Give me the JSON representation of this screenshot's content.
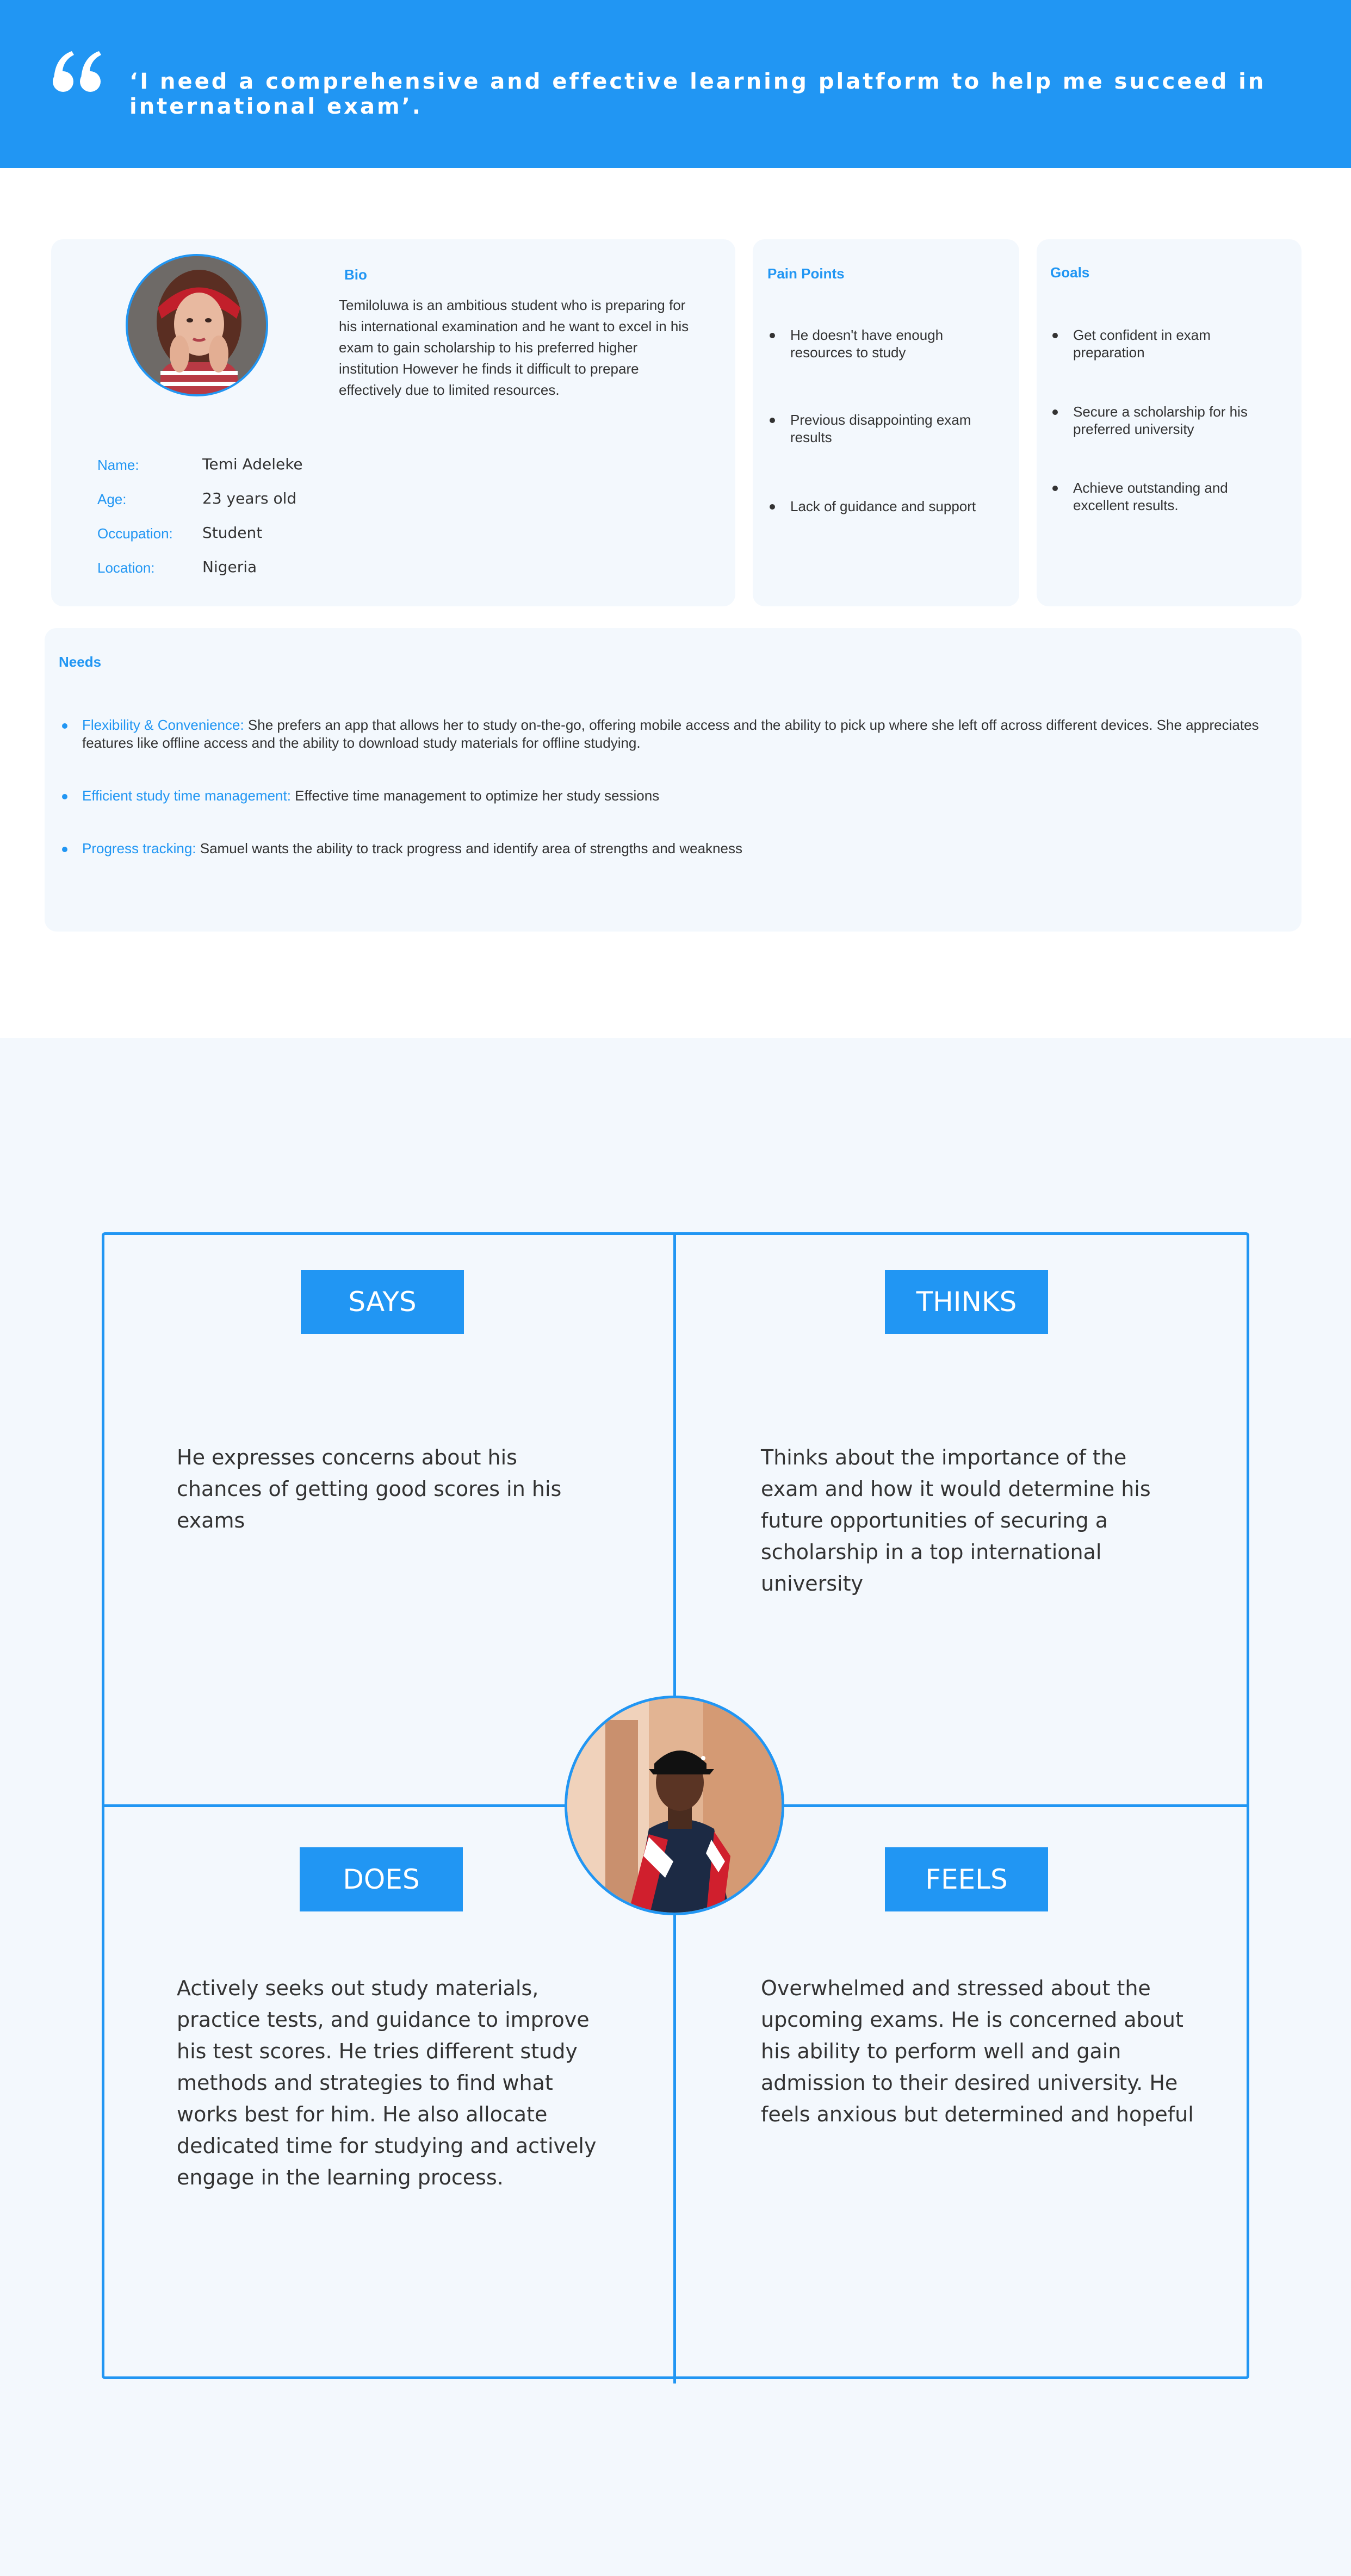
{
  "theme": {
    "accent": "#2196F3",
    "card_bg": "#F3F8FD",
    "text": "#333333",
    "banner_text": "#FFFFFF"
  },
  "banner": {
    "icon": "quote-icon",
    "quote": "‘I need a comprehensive and effective learning platform to help me succeed in international exam’."
  },
  "profile": {
    "avatar": "female-student-avatar",
    "bio_title": "Bio",
    "bio": "Temiloluwa is an ambitious student who is preparing for his international examination and he want to excel in his exam to gain scholarship to his preferred higher institution However he finds it difficult to prepare effectively due to limited resources.",
    "name_label": "Name:",
    "name_value": "Temi Adeleke",
    "age_label": "Age:",
    "age_value": "23  years old",
    "occupation_label": "Occupation:",
    "occupation_value": "Student",
    "location_label": "Location:",
    "location_value": "Nigeria"
  },
  "pain_points": {
    "title": "Pain Points",
    "items": [
      "He doesn't have enough resources to study",
      "Previous disappointing exam results",
      "Lack of guidance and support"
    ]
  },
  "goals": {
    "title": "Goals",
    "items": [
      "Get confident in exam preparation",
      "Secure a scholarship for his preferred university",
      "Achieve outstanding and excellent results."
    ]
  },
  "needs": {
    "title": "Needs",
    "items": [
      {
        "key": "Flexibility & Convenience:",
        "text": "  She prefers an app that allows her to study on-the-go, offering mobile access and the ability to pick up where she left off across different devices. She appreciates features like offline access and the ability to download study materials for offline studying."
      },
      {
        "key": "Efficient study time management:",
        "text": " Effective time management to optimize her study sessions"
      },
      {
        "key": "Progress tracking:",
        "text": " Samuel wants the ability to track progress and identify area of strengths and weakness"
      }
    ]
  },
  "empathy_map": {
    "avatar": "male-student-avatar",
    "says": {
      "label": "SAYS",
      "text": "He expresses concerns about his chances of getting good scores in his exams"
    },
    "thinks": {
      "label": "THINKS",
      "text": "Thinks about the importance of the exam and how it would determine his future opportunities of securing a scholarship in a top international university"
    },
    "does": {
      "label": "DOES",
      "text": "Actively seeks out study materials, practice tests, and guidance to improve his test scores. He tries different study methods and strategies to find what works best for him. He also allocate dedicated time for studying and actively engage in the learning process."
    },
    "feels": {
      "label": "FEELS",
      "text": "Overwhelmed and stressed about the upcoming exams. He is concerned about his ability to perform well and gain admission to their desired university. He feels anxious but determined and hopeful"
    }
  }
}
